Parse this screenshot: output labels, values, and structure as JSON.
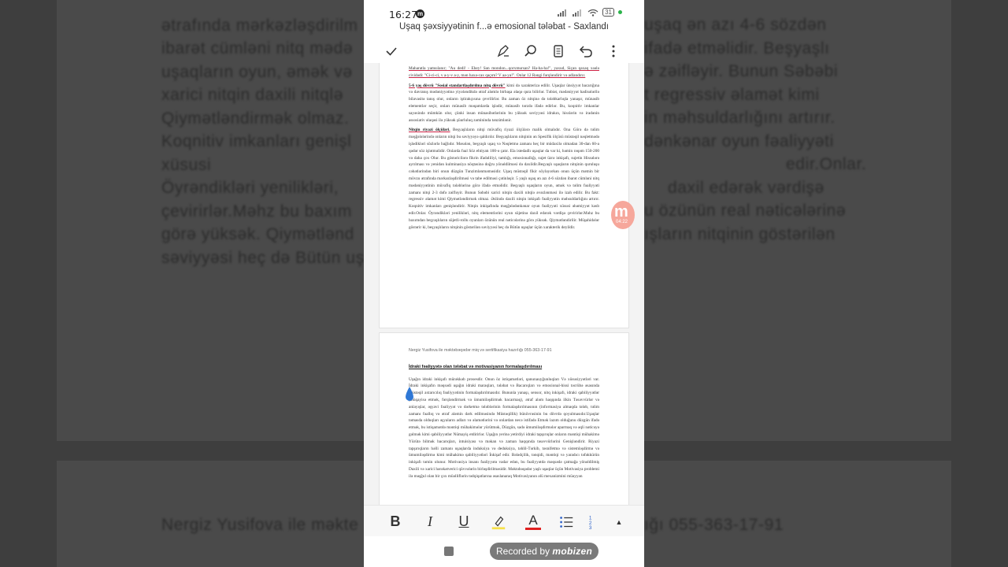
{
  "status": {
    "time": "16:27",
    "battery": "31"
  },
  "app": {
    "title": "Uşaq şəxsiyyətinin f...ə emosional tələbat - Saxlandı"
  },
  "toolbar": {
    "done": "check-icon",
    "edit": "pen-icon",
    "search": "search-icon",
    "view": "reading-view-icon",
    "undo": "undo-icon",
    "more": "more-vertical-icon"
  },
  "page1": {
    "para1": "Maharatla yamsılanır; \"Au dedi! - Ehey! Sən mondon...qorxmursan? Ha-ha-ha!\", yaxud, Siçan qaxaq xəələ cividədi: \"Ci-ci-ci, v a-y-v a-y, mən haxa-cax qaçım? V aa-ya!\". Onlar 12 Rəngi fərqləndirir və adlandırır.",
    "para2_bold": "5-6 yaş dövrü \"Sosial standartlaşdırılma nitq dövrü\"",
    "para2": "kimi də xarakterizə edilir. Uşaqlar ünsiyyət bacarığına və davranış mədəniyyətinə yiyələndikdə ətraf aləmlə birbaşa əlaqə qura bilirlər. Təbiət, mədəniyyət hadisələrilə bilavasitə tanış olur, onların iştirakçısına çevrilirlər. Bu zaman öz nitqinə də tələbkarlıqla yanaşır, münasib elementlər seçir, onları münasib məqamlarda işlədir, münasib tərzdə ifadə edirlər. Bu, koqnitiv imkanlar sayəsində mümkün olur, çünki insan münasibətlərinin bu yüksək səviyyəsi idrakın, hisslərin və iradənin assosiativ əlaqəsi ilə yüksək şüurluluq zəmininda tənzimlənir.",
    "para3_bold": "Nitqin riyazi ölçüləri.",
    "para3": "Beşyaşlıların nitqi müvafiq riyazi ölçülərə malik olmalıdır. Ona Görə də təlim məşğələlərində onların nitqi bu səviyyəyə qaldırılır. Beşyaşlıların nitqinin ən Spesifik ölçüsü müstəqil nəqletmədə işlədikləri sözlərlə bağlıdır. Məsələn, beşyaşlı uşaq və Nəqletmə zamanı heç bir müdaxilə olmadan 30-dan 60-a qədər söz işlətməlidir. Onlarda fəal Söz ehtiyatı 100-ə çatır. Ela istedadlı uşaqlar da var ki, həmin rəqəm 150-200 və daha çox Olur. Bu göstəricilərə fikrin ifadəliliyi, tamlığı, emosionallığı, sujet üzrə inkişafı, sujetin Hissələrə ayrılması və yenidən kulminasiya nöqtəsinə doğru yönəldilməsi də daxildir.Beşyaşlı uşaqların nitqinin quruluşu cəhətlərindən biri onun düzgün Tənzimlənməməsidir. Uşaq müstəqil fikir söyləyərkən onun üçün mətnin bir mövzu ətrafında mərkəzləşdirilməsi və tabe edilməsi çətinləşir. 5 yaşlı uşaq ən azı 4-6 sözdən ibarət cümləni nitq mədəniyyətinin müvafiq tələblərinə görə ifadə etməlidir. Beşyaşlı uşaqların oyun, əmək və təlim fəaliyyəti zamanı nitqi 2-3 dəfə zəifləyir. Bunun Səbəbi xarici nitqin daxili nitqlə əvəzlənməsi ilə izah edilir. Bu fakt: regressiv əlamət kimi Qiymətləndirmək olmaz. Əslində daxili nitqin inkişafı fəaliyyətin məhsuldarlığını artırır. Koqnitiv imkanları genişləndirir. Nitqin inkişafında məşğələdənkənar oyun fəaliyyəti xüsusi əhəmiyyət kəsb edir.Onlar. Öyrəndikləri yenilikləri, nitq elementlərini oyun süjetinə daxil edərək vərdişə çevirirlər.Məhz bu baxımdan beşyaşlıların süjetli-rollu oyunları özünün real nəticələrinə görə yüksək. Qiymətləndirilir. Müşahidələr göstərir ki, beşyaşlıların nitqinin göstərilən səviyyəsi heç də Bütün uşaqlar üçün xarakterik deyildir."
  },
  "page2": {
    "header": "Nergiz Yusifova ile məktəbəqədər miq və sertifikasiya hazırlığı 055-363-17-91",
    "heading": "İdraki fəaliyyətə olan tələbat və motivasiyanın formalaşdırılması",
    "body": "Uşağın idraki inkişafı mürəkkəb prosesdir. Onun öz istiqamətləri, qanunauyğunluqları Və xüsusiyyətləri var. İdraki inkişafın məqsədi uşağın idraki maraqları, tələbat və Bacarıqları və emosional-hissi təcrübə əsasında müstəqil axtarıcılıq fəaliyyətinin formalaşdırılmasıdır. Bununla yanaşı, sensor, nitq inkişafı, idraki qabiliyyətlər (müqayisə etmək, fərqləndirmək və ümumiləşdirmək bacarmaq), ətraf aləm haqqında ilkin Təsəvvürlər və anlayışlar, əşyavi fəaliyyət və dərketmə tələblərinin formalaşdırılmasının (informasiya almaqda tələb, təlim zamanı fəallıq və ətraf aləmin dərk edilməsində Müstəqillik) bünövrəsinin bu dövrdə qoyulmasıdır.Uşaqlar təmasda olduqları əşyaların adları və əlamətlərini və onlardan necə istifadə Etmək lazım olduğunu düzgün ifadə etmək, bu istiqamətdə məntiqi mühakimələr yürütmək, Düzgün, sadə ümumiləşdirmələr aparmaq və əqli nəticəyə gəlmək kimi qabiliyyətlər Nümayiş etdirirlər. Uşağın yerinə yetirdiyi idraki tapşırıqlar onların məntiqi mühakimə Yürütə bilmək bacarıqları, intuisiyası və məkan və zaman haqqında təsəvvürlərini Genişləndirir. Riyazi tapşırıqların həlli zamanı uşaqlarda induksiya və deduksiya, təhlil-Tərkib, təsnifetmə və sistemləşdirmə və ümumiləşdirmə kimi mühakimə qabiliyyətləri İnkişaf edir. Bələdçilik, tənqidi, məntiqi və yaradıcı təfəkkürün inkişafı təmin olunur. Motivasiya insanı fəaliyyətə vadar edən, bu fəaliyyətdə məqsədə çatmağa yönəldilmiş Daxili və xarici hərəkətverici qüvvələrin birləşdirilməsidir. Məktəbəqədər yaşlı uşaqlar üçün Motivasiya problemi ilə məşğul olan bir çox müəlliflərin tədqiqatlarına əsaslanaraq Motivasiyanın əlü mexanizmini müəyyən"
  },
  "recorder": {
    "badge_letter": "m",
    "badge_time": "04:22"
  },
  "format_bar": {
    "bold": "B",
    "italic": "I",
    "underline": "U",
    "highlight": "highlighter-icon",
    "font_color": "A",
    "bullets": "bullet-list-icon",
    "numbering": "numbered-list-icon",
    "expand": "chevron-up-icon"
  },
  "watermark": {
    "prefix": "Recorded by",
    "brand": "mobizen"
  },
  "colors": {
    "font_color_bar": "#e02020",
    "highlight_bar": "#f7e14a",
    "recorder_badge": "#f6a79b"
  },
  "background_left": {
    "lines": [
      "ətrafında mərkəzləşdirilm",
      "ibarət cümləni nitq mədə",
      "uşaqların oyun, əmək və",
      "xarici nitqin daxili nitqlə",
      "Qiymətləndirmək olmaz. ",
      "Koqnitiv imkanları genişl",
      "xüsusi",
      "Öyrəndikləri yenilikləri,",
      "çevirirlər.Məhz bu baxım",
      "görə yüksək. Qiymətlənd",
      "səviyyəsi heç də Bütün uş"
    ],
    "footer": "Nergiz Yusifova ile məkte"
  },
  "background_right": {
    "lines": [
      "uşaq ən azı 4-6 sözdən",
      "ifadə etməlidir. Beşyaşlı",
      "ə zəifləyir. Bunun Səbəbi",
      "t regressiv əlamət kimi",
      "in məhsuldarlığını artırır.",
      "dənkənar oyun fəaliyyəti",
      "edir.Onlar.",
      "daxil edərək vərdişə",
      "u özünün real nəticələrinə",
      "ışların nitqinin göstərilən"
    ],
    "footer": "ığı 055-363-17-91"
  }
}
